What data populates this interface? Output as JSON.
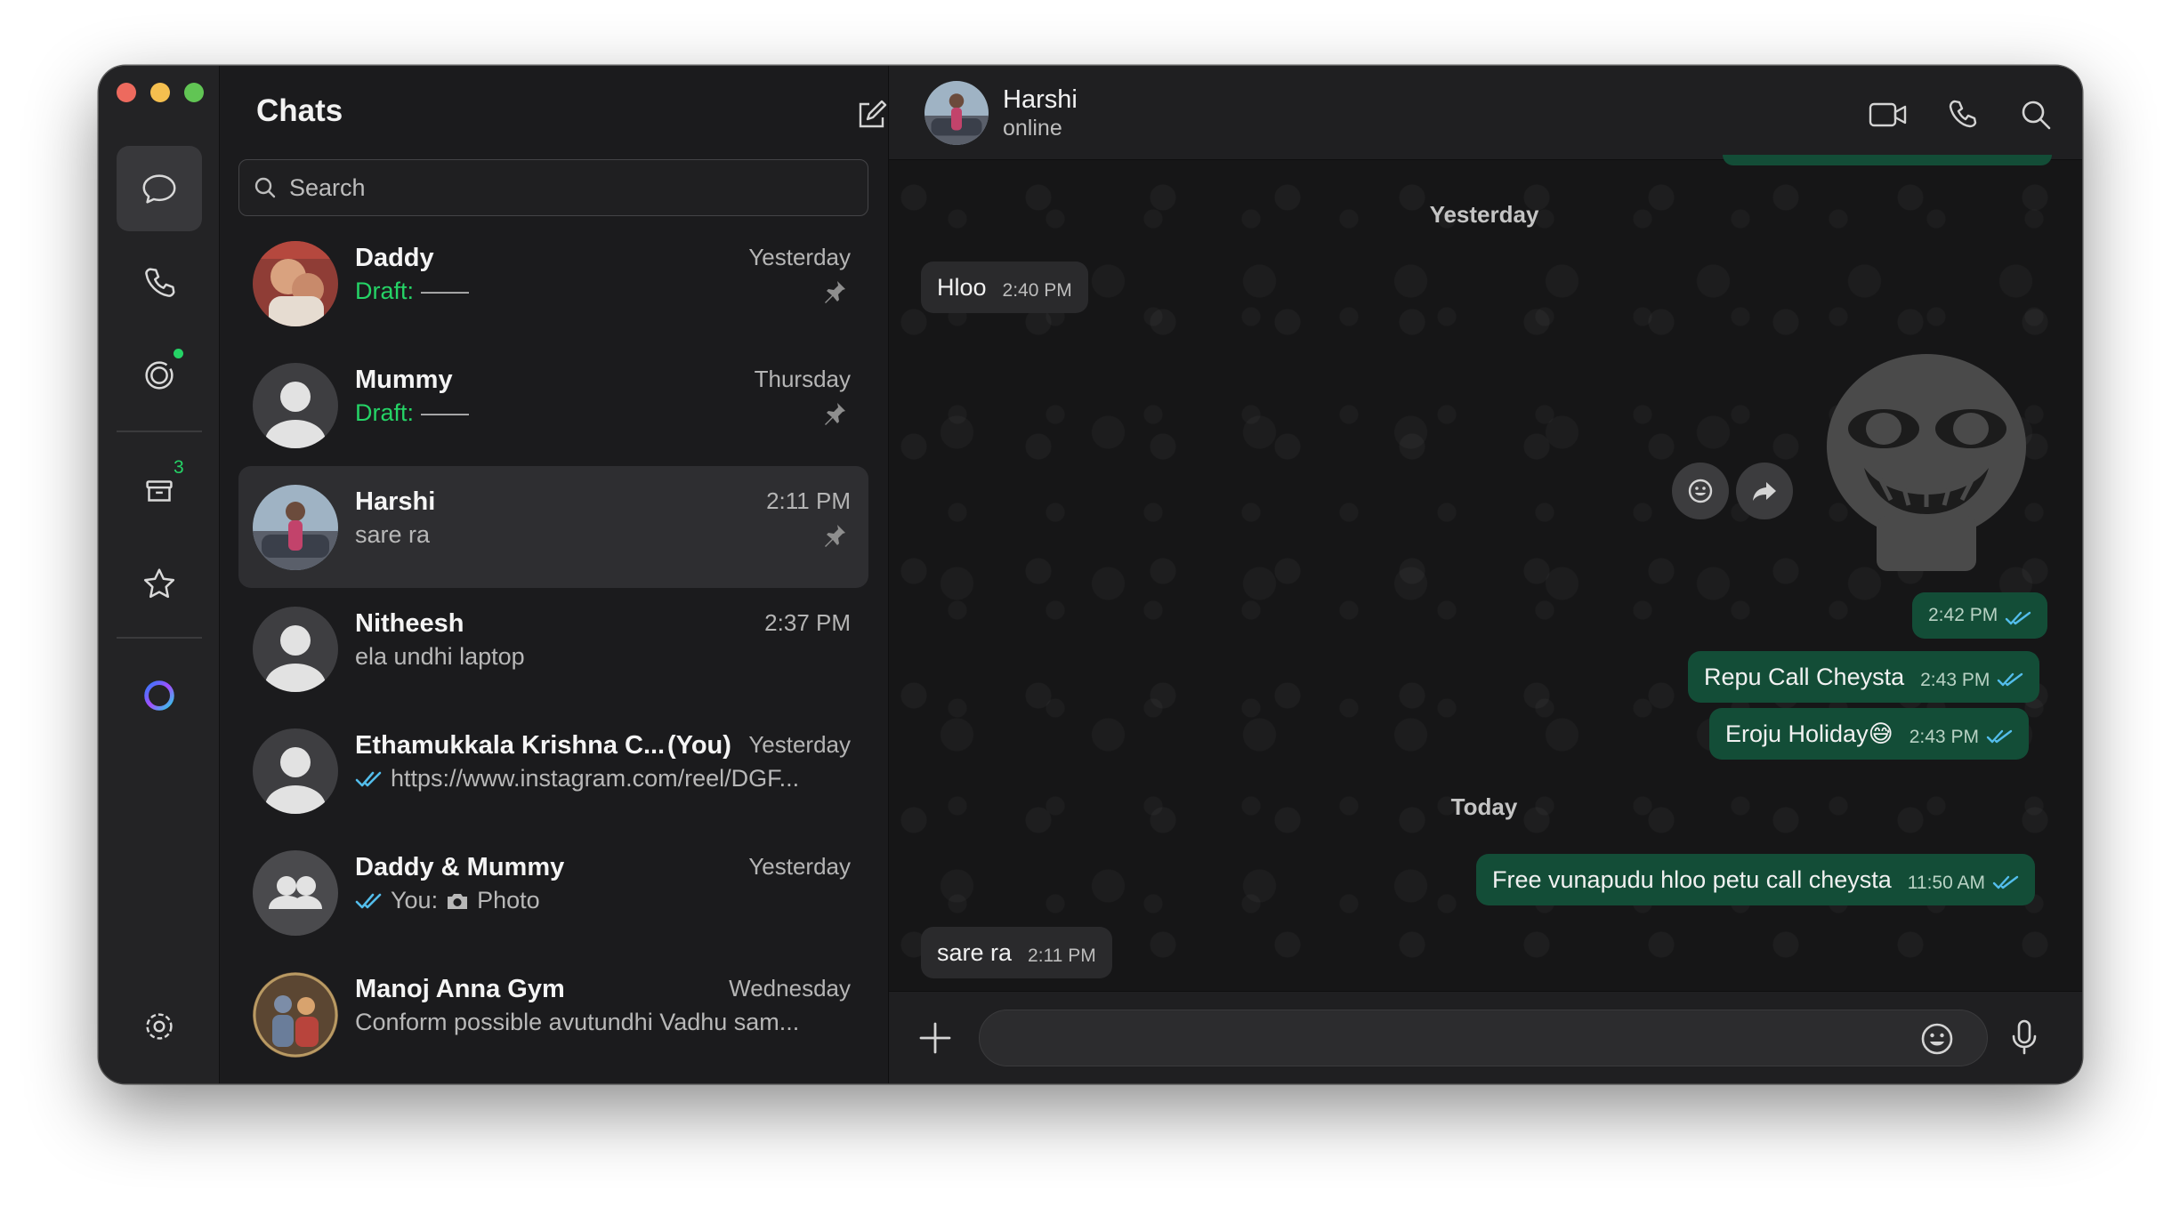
{
  "rail": {
    "archived_count": "3"
  },
  "chat_list": {
    "title": "Chats",
    "search_placeholder": "Search",
    "chats": [
      {
        "name": "Daddy",
        "time": "Yesterday",
        "draft_label": "Draft:",
        "preview": "——",
        "pinned": true
      },
      {
        "name": "Mummy",
        "time": "Thursday",
        "draft_label": "Draft:",
        "preview": "——",
        "pinned": true
      },
      {
        "name": "Harshi",
        "time": "2:11 PM",
        "preview": "sare ra",
        "pinned": true,
        "selected": true
      },
      {
        "name": "Nitheesh",
        "time": "2:37 PM",
        "preview": "ela undhi laptop"
      },
      {
        "name": "Ethamukkala Krishna C...",
        "you_tag": "(You)",
        "time": "Yesterday",
        "preview": "https://www.instagram.com/reel/DGF..."
      },
      {
        "name": "Daddy & Mummy",
        "time": "Yesterday",
        "preview_prefix": "You:",
        "preview": "Photo"
      },
      {
        "name": "Manoj Anna Gym",
        "time": "Wednesday",
        "preview": "Conform possible avutundhi Vadhu sam..."
      }
    ]
  },
  "conversation": {
    "contact_name": "Harshi",
    "contact_status": "online",
    "date_yesterday": "Yesterday",
    "date_today": "Today",
    "messages": [
      {
        "dir": "in",
        "text": "Hloo",
        "time": "2:40 PM"
      },
      {
        "dir": "out",
        "text": "",
        "time": "2:42 PM",
        "sticker": true
      },
      {
        "dir": "out",
        "text": "Repu Call Cheysta",
        "time": "2:43 PM"
      },
      {
        "dir": "out",
        "text": "Eroju Holiday😅",
        "time": "2:43 PM"
      },
      {
        "dir": "out",
        "text": "Free vunapudu hloo petu call cheysta",
        "time": "11:50 AM"
      },
      {
        "dir": "in",
        "text": "sare ra",
        "time": "2:11 PM"
      }
    ],
    "composer_placeholder": ""
  },
  "colors": {
    "accent_green": "#25d366",
    "outgoing_bubble": "#134d37",
    "incoming_bubble": "#2a2a2c",
    "read_tick": "#53bdeb"
  }
}
